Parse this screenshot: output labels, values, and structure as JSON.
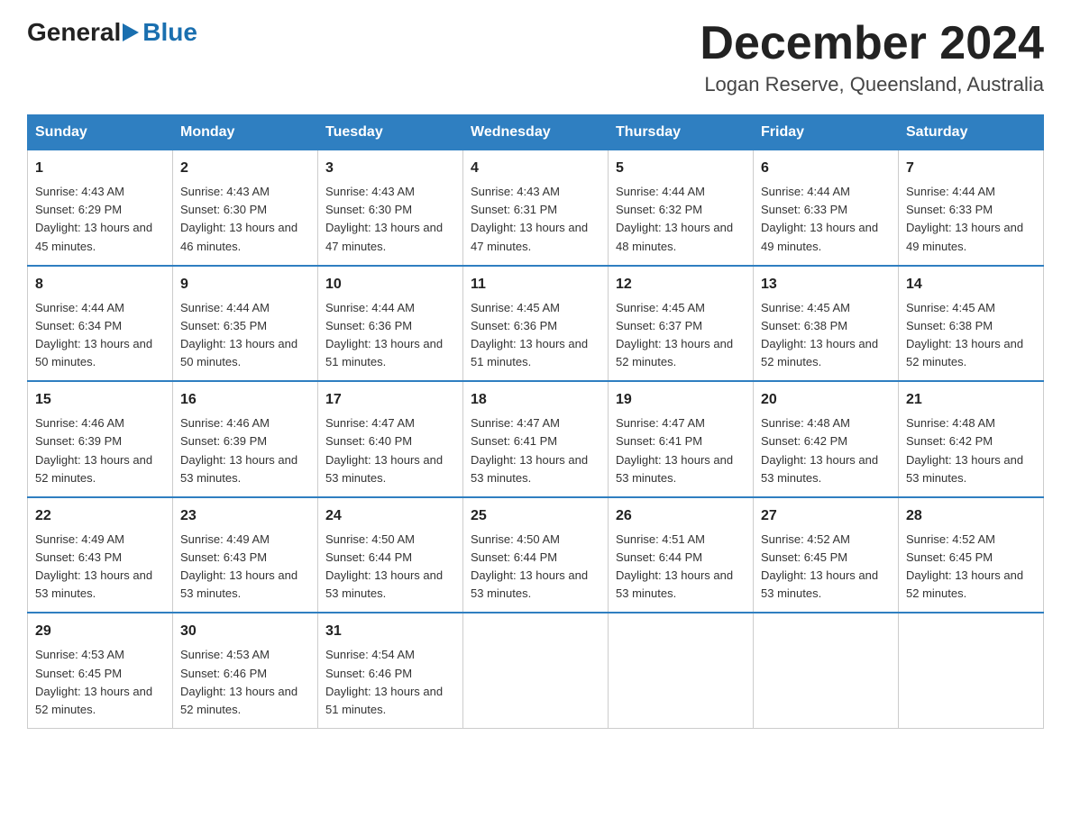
{
  "logo": {
    "general": "General",
    "blue": "Blue",
    "underline": "Blue"
  },
  "title": {
    "month_year": "December 2024",
    "location": "Logan Reserve, Queensland, Australia"
  },
  "headers": [
    "Sunday",
    "Monday",
    "Tuesday",
    "Wednesday",
    "Thursday",
    "Friday",
    "Saturday"
  ],
  "weeks": [
    [
      {
        "day": "1",
        "sunrise": "4:43 AM",
        "sunset": "6:29 PM",
        "daylight": "13 hours and 45 minutes."
      },
      {
        "day": "2",
        "sunrise": "4:43 AM",
        "sunset": "6:30 PM",
        "daylight": "13 hours and 46 minutes."
      },
      {
        "day": "3",
        "sunrise": "4:43 AM",
        "sunset": "6:30 PM",
        "daylight": "13 hours and 47 minutes."
      },
      {
        "day": "4",
        "sunrise": "4:43 AM",
        "sunset": "6:31 PM",
        "daylight": "13 hours and 47 minutes."
      },
      {
        "day": "5",
        "sunrise": "4:44 AM",
        "sunset": "6:32 PM",
        "daylight": "13 hours and 48 minutes."
      },
      {
        "day": "6",
        "sunrise": "4:44 AM",
        "sunset": "6:33 PM",
        "daylight": "13 hours and 49 minutes."
      },
      {
        "day": "7",
        "sunrise": "4:44 AM",
        "sunset": "6:33 PM",
        "daylight": "13 hours and 49 minutes."
      }
    ],
    [
      {
        "day": "8",
        "sunrise": "4:44 AM",
        "sunset": "6:34 PM",
        "daylight": "13 hours and 50 minutes."
      },
      {
        "day": "9",
        "sunrise": "4:44 AM",
        "sunset": "6:35 PM",
        "daylight": "13 hours and 50 minutes."
      },
      {
        "day": "10",
        "sunrise": "4:44 AM",
        "sunset": "6:36 PM",
        "daylight": "13 hours and 51 minutes."
      },
      {
        "day": "11",
        "sunrise": "4:45 AM",
        "sunset": "6:36 PM",
        "daylight": "13 hours and 51 minutes."
      },
      {
        "day": "12",
        "sunrise": "4:45 AM",
        "sunset": "6:37 PM",
        "daylight": "13 hours and 52 minutes."
      },
      {
        "day": "13",
        "sunrise": "4:45 AM",
        "sunset": "6:38 PM",
        "daylight": "13 hours and 52 minutes."
      },
      {
        "day": "14",
        "sunrise": "4:45 AM",
        "sunset": "6:38 PM",
        "daylight": "13 hours and 52 minutes."
      }
    ],
    [
      {
        "day": "15",
        "sunrise": "4:46 AM",
        "sunset": "6:39 PM",
        "daylight": "13 hours and 52 minutes."
      },
      {
        "day": "16",
        "sunrise": "4:46 AM",
        "sunset": "6:39 PM",
        "daylight": "13 hours and 53 minutes."
      },
      {
        "day": "17",
        "sunrise": "4:47 AM",
        "sunset": "6:40 PM",
        "daylight": "13 hours and 53 minutes."
      },
      {
        "day": "18",
        "sunrise": "4:47 AM",
        "sunset": "6:41 PM",
        "daylight": "13 hours and 53 minutes."
      },
      {
        "day": "19",
        "sunrise": "4:47 AM",
        "sunset": "6:41 PM",
        "daylight": "13 hours and 53 minutes."
      },
      {
        "day": "20",
        "sunrise": "4:48 AM",
        "sunset": "6:42 PM",
        "daylight": "13 hours and 53 minutes."
      },
      {
        "day": "21",
        "sunrise": "4:48 AM",
        "sunset": "6:42 PM",
        "daylight": "13 hours and 53 minutes."
      }
    ],
    [
      {
        "day": "22",
        "sunrise": "4:49 AM",
        "sunset": "6:43 PM",
        "daylight": "13 hours and 53 minutes."
      },
      {
        "day": "23",
        "sunrise": "4:49 AM",
        "sunset": "6:43 PM",
        "daylight": "13 hours and 53 minutes."
      },
      {
        "day": "24",
        "sunrise": "4:50 AM",
        "sunset": "6:44 PM",
        "daylight": "13 hours and 53 minutes."
      },
      {
        "day": "25",
        "sunrise": "4:50 AM",
        "sunset": "6:44 PM",
        "daylight": "13 hours and 53 minutes."
      },
      {
        "day": "26",
        "sunrise": "4:51 AM",
        "sunset": "6:44 PM",
        "daylight": "13 hours and 53 minutes."
      },
      {
        "day": "27",
        "sunrise": "4:52 AM",
        "sunset": "6:45 PM",
        "daylight": "13 hours and 53 minutes."
      },
      {
        "day": "28",
        "sunrise": "4:52 AM",
        "sunset": "6:45 PM",
        "daylight": "13 hours and 52 minutes."
      }
    ],
    [
      {
        "day": "29",
        "sunrise": "4:53 AM",
        "sunset": "6:45 PM",
        "daylight": "13 hours and 52 minutes."
      },
      {
        "day": "30",
        "sunrise": "4:53 AM",
        "sunset": "6:46 PM",
        "daylight": "13 hours and 52 minutes."
      },
      {
        "day": "31",
        "sunrise": "4:54 AM",
        "sunset": "6:46 PM",
        "daylight": "13 hours and 51 minutes."
      },
      null,
      null,
      null,
      null
    ]
  ]
}
